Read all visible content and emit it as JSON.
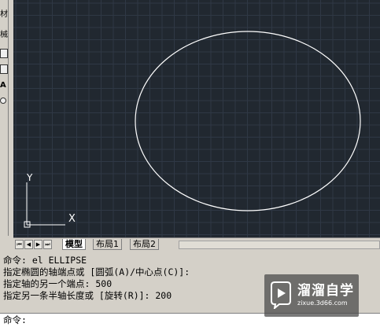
{
  "toolbar": {
    "glyphs": [
      "材",
      "械"
    ],
    "icons": [
      "toolbar-icon",
      "toolbar-icon",
      "text-icon",
      "toolbar-icon"
    ]
  },
  "canvas": {
    "background": "#212830",
    "grid_color": "#2f3845",
    "shape": {
      "type": "ellipse",
      "stroke": "#ffffff"
    },
    "ucs": {
      "y_label": "Y",
      "x_label": "X"
    }
  },
  "tabs": {
    "items": [
      {
        "label": "模型",
        "active": true
      },
      {
        "label": "布局1",
        "active": false
      },
      {
        "label": "布局2",
        "active": false
      }
    ],
    "nav_buttons": [
      "first-icon",
      "prev-icon",
      "next-icon",
      "last-icon"
    ]
  },
  "command": {
    "history": [
      "命令: el ELLIPSE",
      "指定椭圆的轴端点或 [圆弧(A)/中心点(C)]:",
      "指定轴的另一个端点: 500",
      "指定另一条半轴长度或 [旋转(R)]: 200"
    ],
    "prompt_label": "命令:",
    "input_value": ""
  },
  "watermark": {
    "title": "溜溜自学",
    "subtitle": "zixue.3d66.com"
  }
}
